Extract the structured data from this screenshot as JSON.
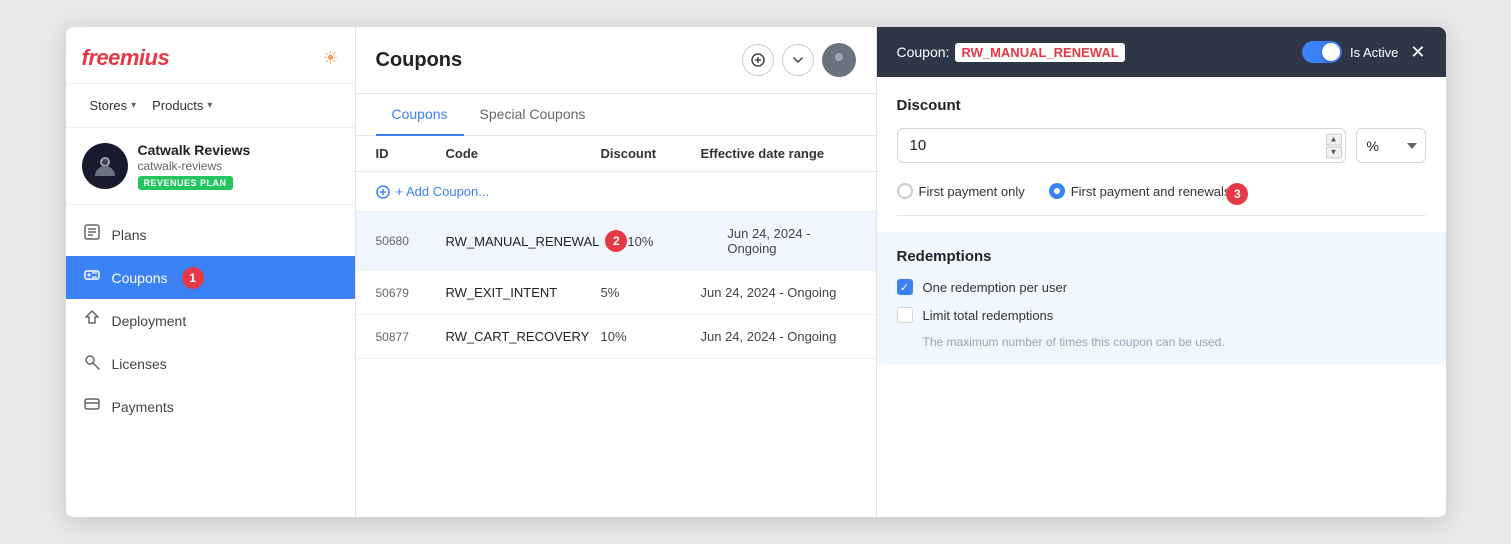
{
  "logo": {
    "text": "freemius"
  },
  "nav": {
    "stores_label": "Stores",
    "products_label": "Products"
  },
  "store": {
    "name": "Catwalk Reviews",
    "slug": "catwalk-reviews",
    "badge": "REVENUES PLAN"
  },
  "sidebar": {
    "items": [
      {
        "id": "plans",
        "label": "Plans",
        "icon": "📋"
      },
      {
        "id": "coupons",
        "label": "Coupons",
        "icon": "🏷️",
        "active": true
      },
      {
        "id": "deployment",
        "label": "Deployment",
        "icon": "🚀"
      },
      {
        "id": "licenses",
        "label": "Licenses",
        "icon": "🔑"
      },
      {
        "id": "payments",
        "label": "Payments",
        "icon": "💳"
      }
    ]
  },
  "main": {
    "title": "Coupons",
    "tabs": [
      {
        "id": "coupons",
        "label": "Coupons",
        "active": true
      },
      {
        "id": "special",
        "label": "Special Coupons"
      }
    ],
    "table": {
      "headers": [
        "ID",
        "Code",
        "Discount",
        "Effective date range"
      ],
      "add_label": "+ Add Coupon...",
      "rows": [
        {
          "id": "50680",
          "code": "RW_MANUAL_RENEWAL",
          "discount": "10%",
          "date": "Jun 24, 2024 - Ongoing",
          "selected": true,
          "has_badge": true
        },
        {
          "id": "50679",
          "code": "RW_EXIT_INTENT",
          "discount": "5%",
          "date": "Jun 24, 2024 - Ongoing"
        },
        {
          "id": "50877",
          "code": "RW_CART_RECOVERY",
          "discount": "10%",
          "date": "Jun 24, 2024 - Ongoing"
        }
      ]
    }
  },
  "panel": {
    "coupon_prefix": "Coupon:",
    "coupon_name": "RW_MANUAL_RENEWAL",
    "is_active_label": "Is Active",
    "discount_section": "Discount",
    "discount_value": "10",
    "discount_unit": "%",
    "discount_units": [
      "%",
      "$"
    ],
    "payment_options": [
      {
        "id": "first_only",
        "label": "First payment only",
        "selected": false
      },
      {
        "id": "first_renewals",
        "label": "First payment and renewals",
        "selected": true
      }
    ],
    "redemptions_section": "Redemptions",
    "checkboxes": [
      {
        "id": "one_per_user",
        "label": "One redemption per user",
        "checked": true
      },
      {
        "id": "limit_total",
        "label": "Limit total redemptions",
        "checked": false
      }
    ],
    "help_text": "The maximum number of times this coupon can be used."
  },
  "badges": {
    "b1": "1",
    "b2": "2",
    "b3": "3"
  }
}
